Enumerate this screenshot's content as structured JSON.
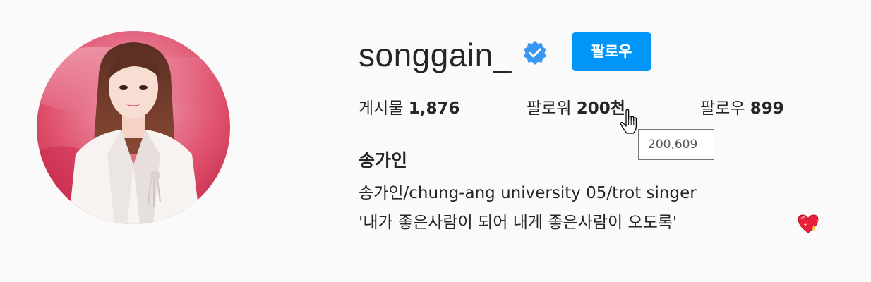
{
  "profile": {
    "username": "songgain_",
    "verified_icon": "verified-badge-icon",
    "follow_label": "팔로우",
    "accent_color": "#0095f6",
    "stats": {
      "posts_label": "게시물",
      "posts_count": "1,876",
      "followers_label": "팔로워",
      "followers_count": "200천",
      "following_label": "팔로우",
      "following_count": "899"
    },
    "followers_tooltip": "200,609",
    "full_name": "송가인",
    "bio_lines": [
      "송가인/chung-ang university 05/trot singer",
      "'내가 좋은사람이 되어 내게 좋은사람이 오도록'"
    ],
    "bio_emoji_icon": "sparkling-heart-icon"
  }
}
